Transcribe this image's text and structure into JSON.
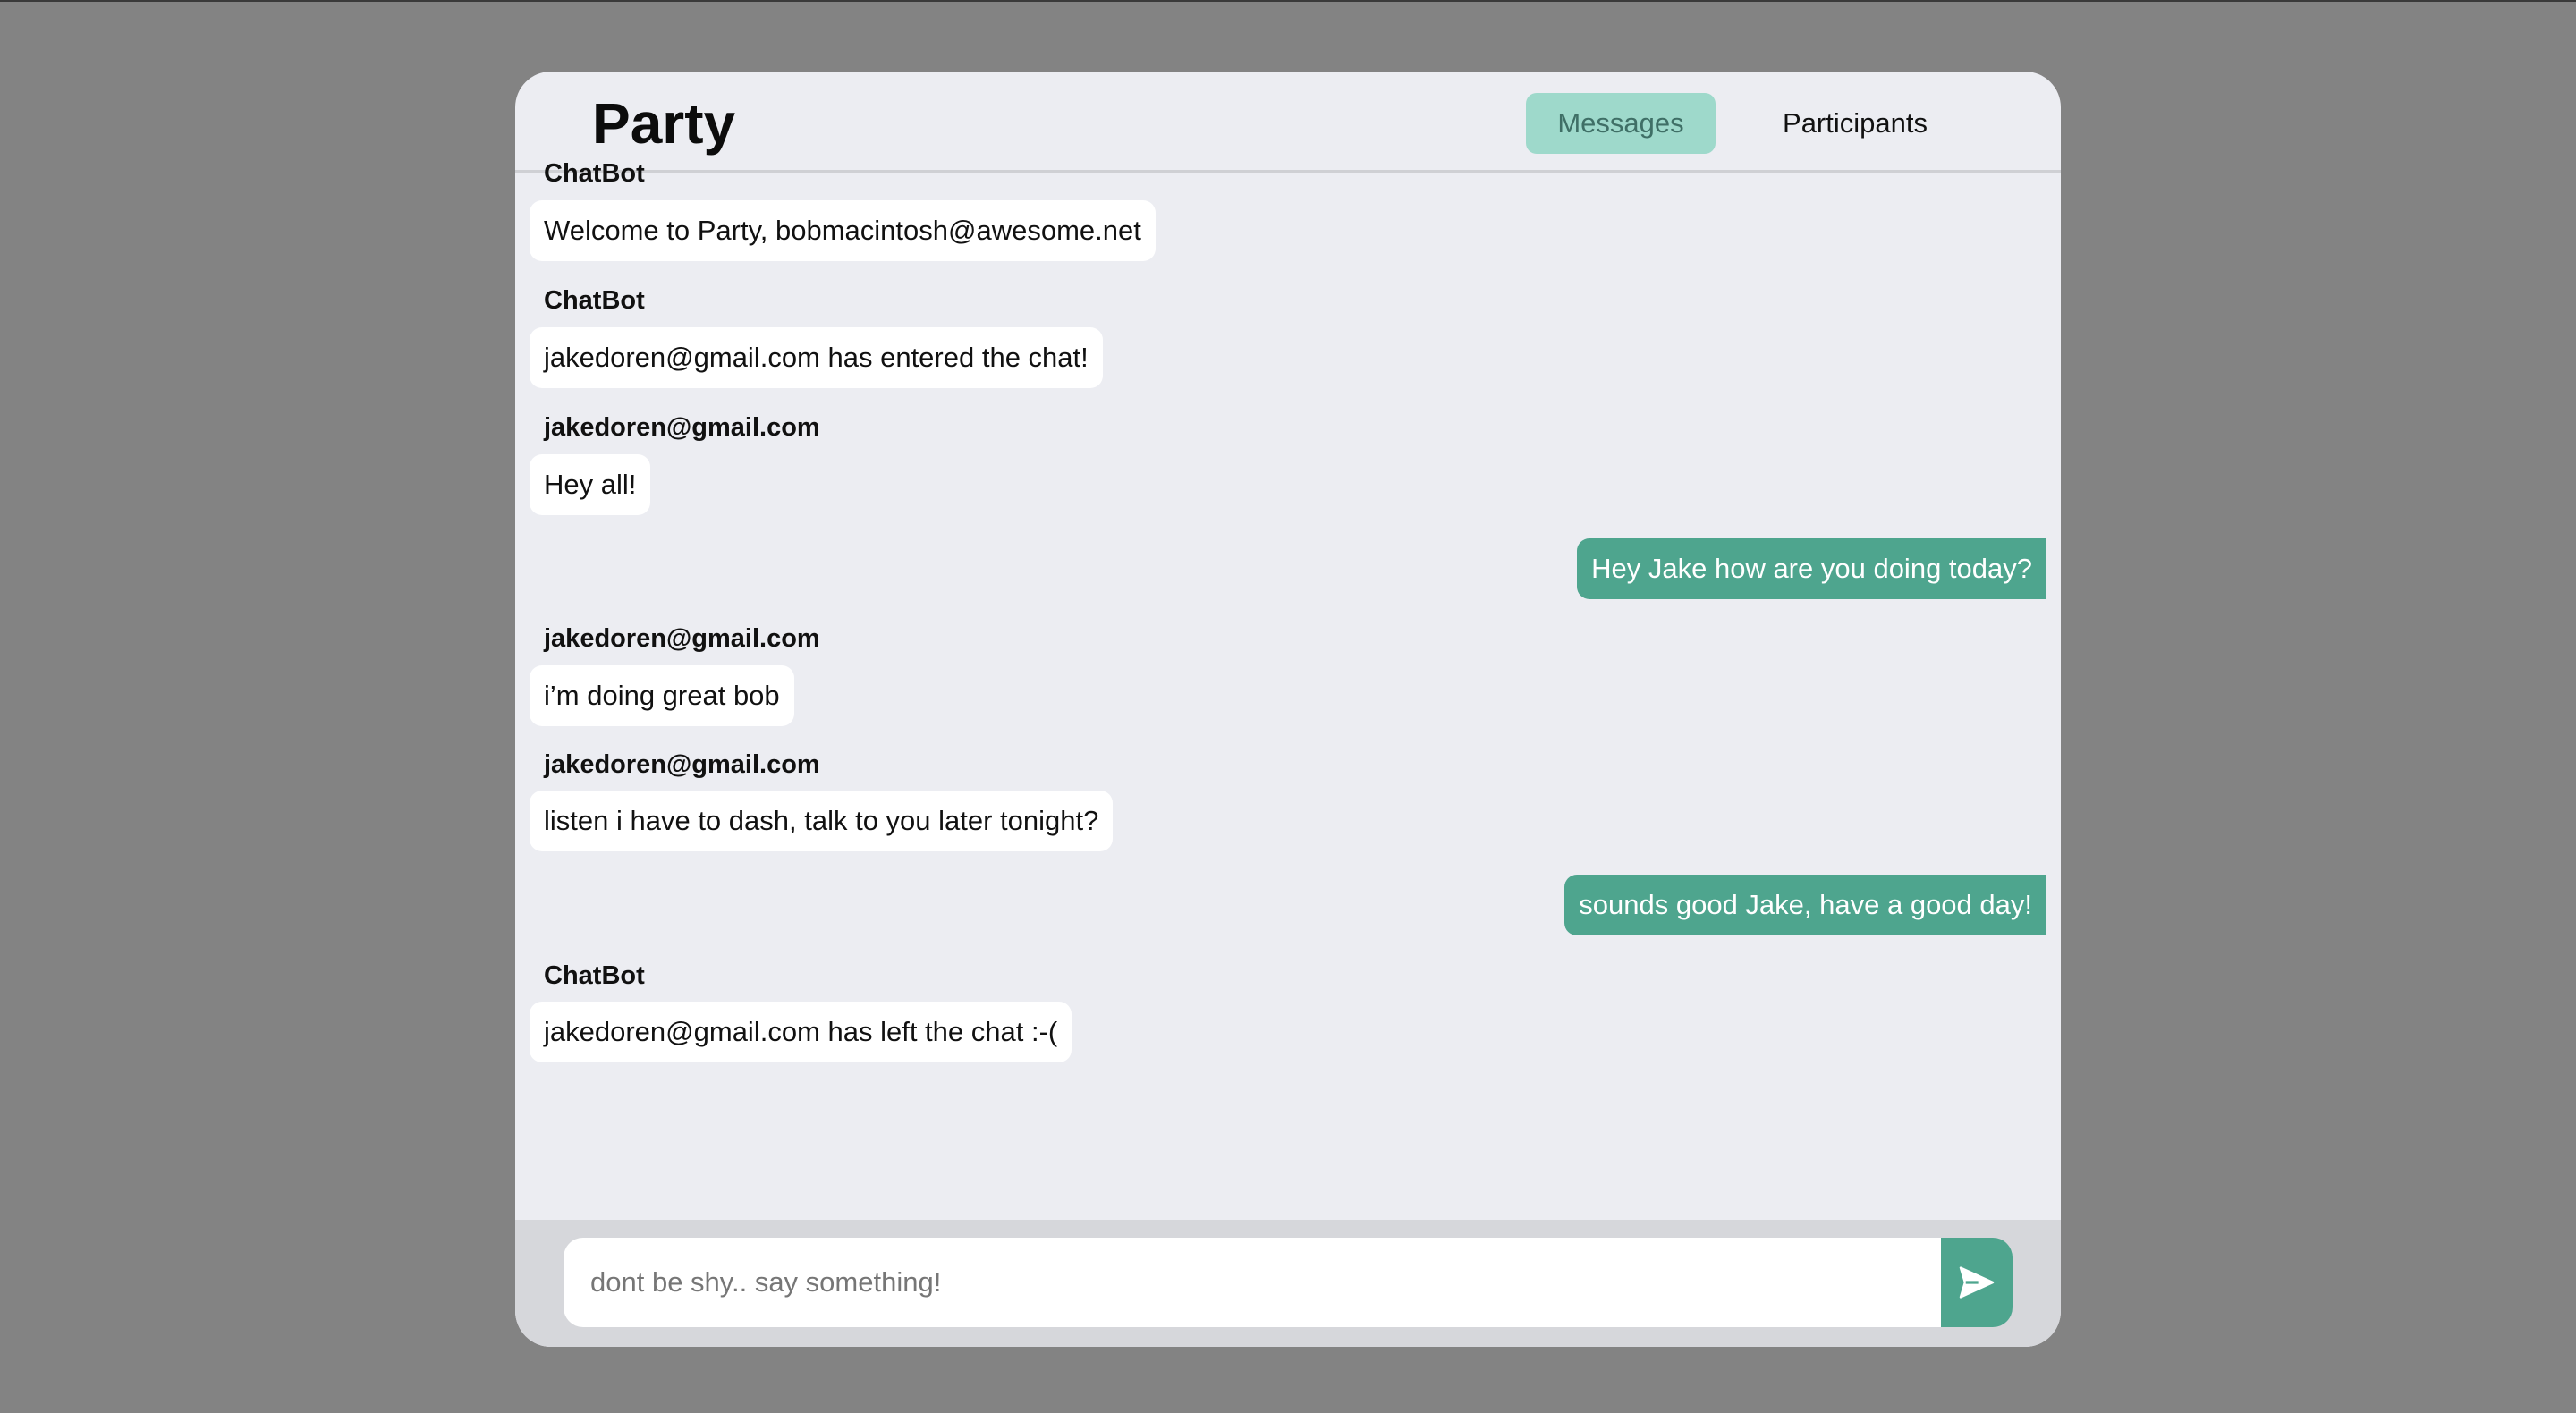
{
  "header": {
    "title": "Party",
    "tabs": [
      {
        "label": "Messages",
        "active": true
      },
      {
        "label": "Participants",
        "active": false
      }
    ]
  },
  "messages": [
    {
      "sender": "ChatBot",
      "text": "Welcome to Party, bobmacintosh@awesome.net",
      "outgoing": false
    },
    {
      "sender": "ChatBot",
      "text": "jakedoren@gmail.com has entered the chat!",
      "outgoing": false
    },
    {
      "sender": "jakedoren@gmail.com",
      "text": "Hey all!",
      "outgoing": false
    },
    {
      "sender": "",
      "text": "Hey Jake how are you doing today?",
      "outgoing": true
    },
    {
      "sender": "jakedoren@gmail.com",
      "text": "i’m doing great bob",
      "outgoing": false
    },
    {
      "sender": "jakedoren@gmail.com",
      "text": "listen i have to dash, talk to you later tonight?",
      "outgoing": false
    },
    {
      "sender": "",
      "text": "sounds good Jake, have a good day!",
      "outgoing": true
    },
    {
      "sender": "ChatBot",
      "text": "jakedoren@gmail.com has left the chat :-(",
      "outgoing": false
    }
  ],
  "composer": {
    "placeholder": "dont be shy.. say something!",
    "value": "",
    "send_icon": "send-icon"
  },
  "colors": {
    "accent": "#4ea58e",
    "tab_active_bg": "#9ed9cb",
    "background": "#838383",
    "panel": "#ecedf2"
  }
}
